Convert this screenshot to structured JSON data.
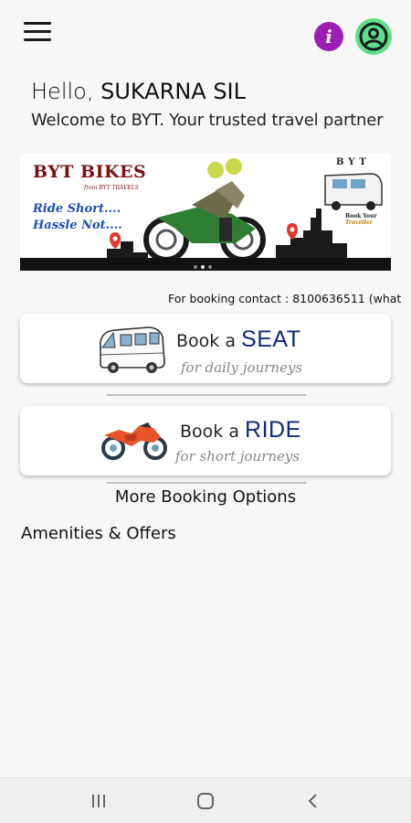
{
  "header": {
    "menu_icon": "hamburger-menu-icon",
    "info_icon": "info-icon",
    "info_glyph": "i",
    "profile_icon": "account-circle-icon",
    "accent_colors": {
      "info": "#9b1fb5",
      "profile": "#5ce08a"
    }
  },
  "greeting": {
    "hello": "Hello,",
    "name": "SUKARNA SIL",
    "welcome": "Welcome to BYT. Your trusted travel partner"
  },
  "banner": {
    "brand": "BYT BIKES",
    "brand_sub": "from BYT TRAVELS",
    "tagline_1": "Ride Short....",
    "tagline_2": "Hassle Not....",
    "corner_brand": "BYT",
    "corner_caption_1": "Book Your",
    "corner_caption_2": "Traveller",
    "slides": 3,
    "active_slide": 2
  },
  "contact": {
    "text": "For booking contact : 8100636511 (what"
  },
  "cards": {
    "seat": {
      "prefix": "Book a",
      "keyword": "SEAT",
      "subtitle": "for daily journeys",
      "icon": "van-icon"
    },
    "ride": {
      "prefix": "Book a",
      "keyword": "RIDE",
      "subtitle": "for short journeys",
      "icon": "motorbike-icon"
    }
  },
  "more_options": "More Booking Options",
  "amenities": "Amenities & Offers",
  "navbar": {
    "recents_icon": "recent-apps-icon",
    "home_icon": "home-icon",
    "back_icon": "back-icon"
  }
}
